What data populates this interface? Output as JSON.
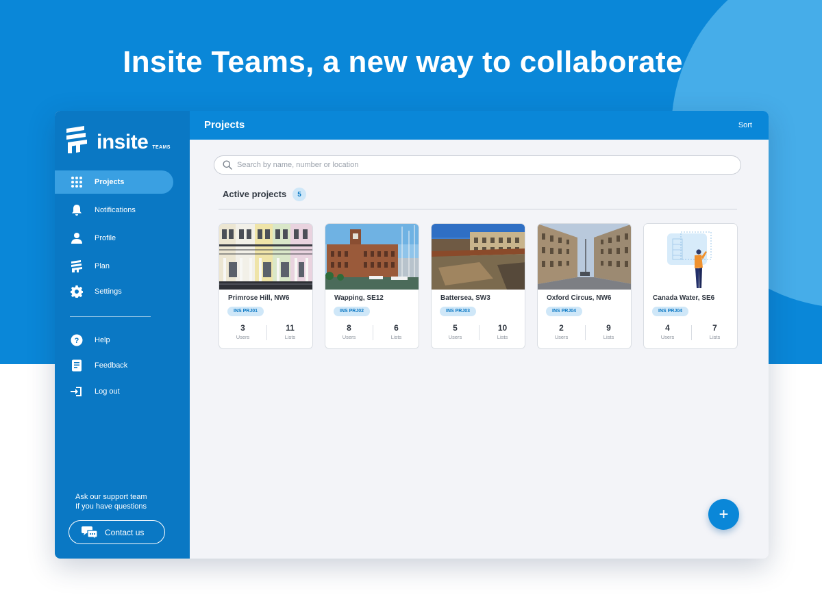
{
  "headline": "Insite Teams, a new way to collaborate",
  "brand": {
    "name": "insite",
    "sub": "TEAMS"
  },
  "sidebar": {
    "items": [
      {
        "label": "Projects",
        "icon": "grid-icon",
        "active": true
      },
      {
        "label": "Notifications",
        "icon": "bell-icon"
      },
      {
        "label": "Profile",
        "icon": "user-icon"
      },
      {
        "label": "Plan",
        "icon": "plan-icon"
      },
      {
        "label": "Settings",
        "icon": "gear-icon"
      }
    ],
    "secondary": [
      {
        "label": "Help",
        "icon": "help-icon"
      },
      {
        "label": "Feedback",
        "icon": "feedback-icon"
      },
      {
        "label": "Log out",
        "icon": "logout-icon"
      }
    ],
    "support_line1": "Ask our support team",
    "support_line2": "If you have questions",
    "contact_label": "Contact us"
  },
  "topbar": {
    "title": "Projects",
    "sort_label": "Sort"
  },
  "search": {
    "placeholder": "Search by name, number or location",
    "value": ""
  },
  "section": {
    "title": "Active projects",
    "count": "5"
  },
  "projects": [
    {
      "name": "Primrose Hill, NW6",
      "code": "INS PRJ01",
      "users": "3",
      "lists": "11",
      "users_label": "Users",
      "lists_label": "Lists"
    },
    {
      "name": "Wapping, SE12",
      "code": "INS PRJ02",
      "users": "8",
      "lists": "6",
      "users_label": "Users",
      "lists_label": "Lists"
    },
    {
      "name": "Battersea, SW3",
      "code": "INS PRJ03",
      "users": "5",
      "lists": "10",
      "users_label": "Users",
      "lists_label": "Lists"
    },
    {
      "name": "Oxford Circus, NW6",
      "code": "INS PRJ04",
      "users": "2",
      "lists": "9",
      "users_label": "Users",
      "lists_label": "Lists"
    },
    {
      "name": "Canada Water, SE6",
      "code": "INS PRJ04",
      "users": "4",
      "lists": "7",
      "users_label": "Users",
      "lists_label": "Lists"
    }
  ],
  "fab_label": "+",
  "colors": {
    "primary": "#0a87d8",
    "sidebar": "#0a78c4",
    "active": "#3aa0e2",
    "badge": "#cfe7f8"
  }
}
